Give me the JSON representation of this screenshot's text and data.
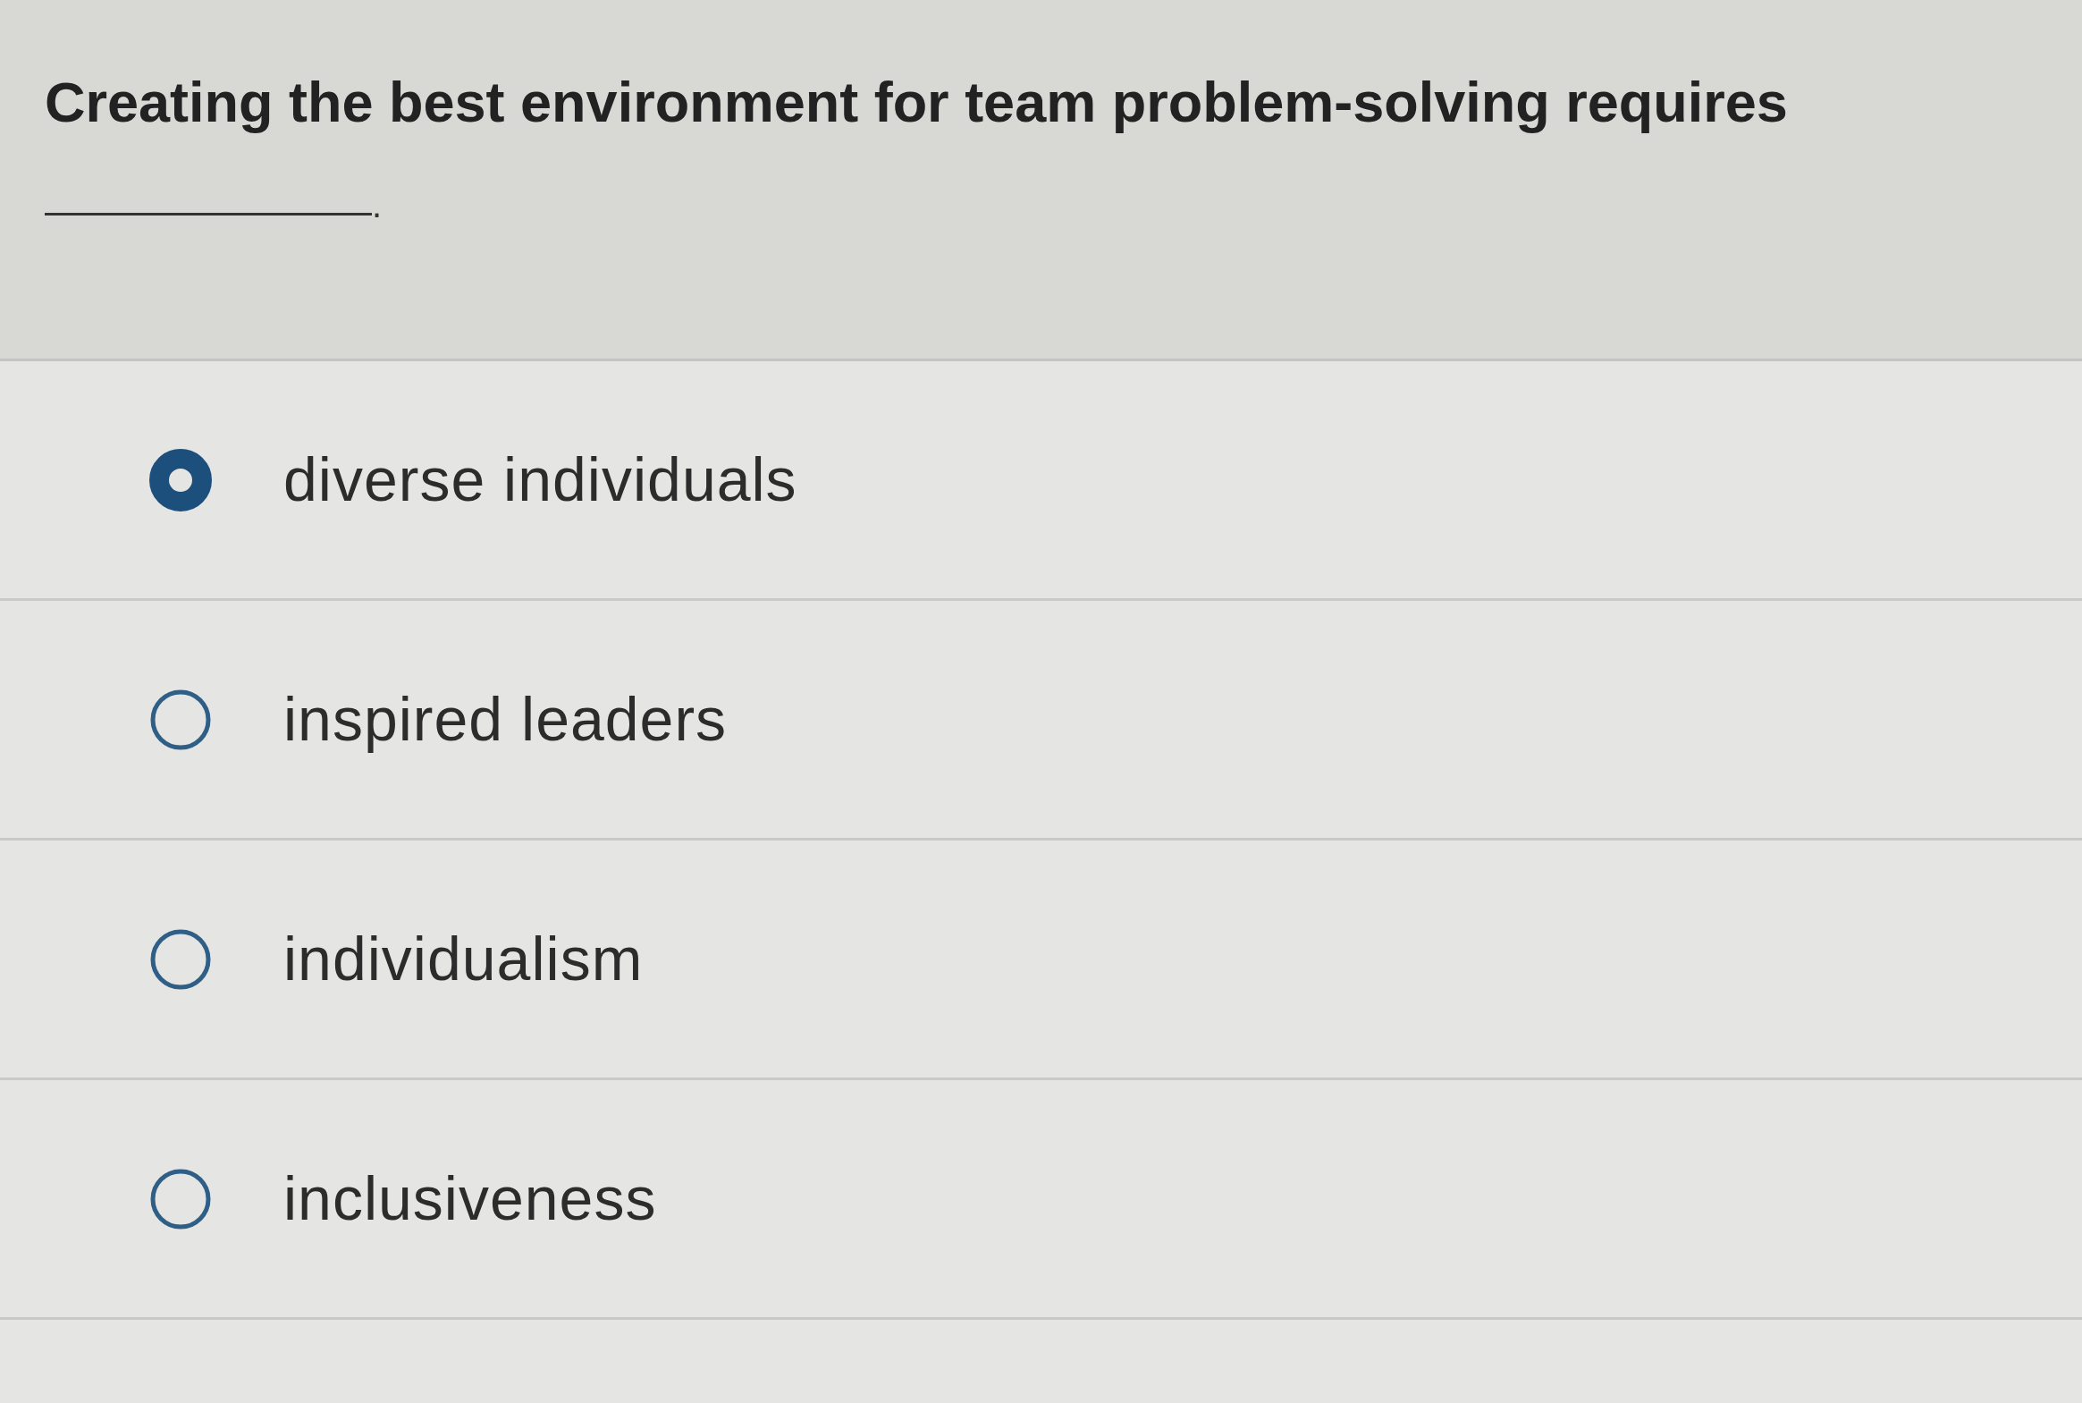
{
  "question": {
    "text": "Creating the best environment for team problem-solving requires",
    "after_blank": "."
  },
  "options": [
    {
      "label": "diverse individuals",
      "selected": true
    },
    {
      "label": "inspired leaders",
      "selected": false
    },
    {
      "label": "individualism",
      "selected": false
    },
    {
      "label": "inclusiveness",
      "selected": false
    }
  ]
}
